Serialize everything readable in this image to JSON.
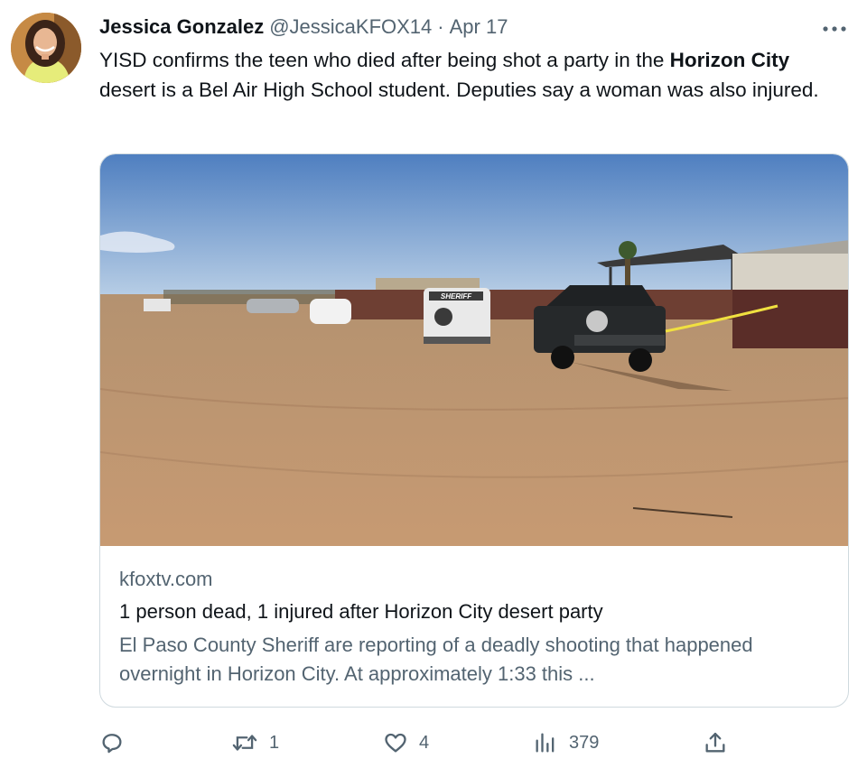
{
  "author": {
    "name": "Jessica Gonzalez",
    "handle": "@JessicaKFOX14",
    "separator": "·",
    "date": "Apr 17"
  },
  "tweet": {
    "text_part1": "YISD confirms the teen who died after being shot a party in the ",
    "text_bold": "Horizon City",
    "text_part2": " desert is a Bel Air High School student. Deputies say a woman was also injured."
  },
  "card": {
    "image_sign": "SHERIFF",
    "domain": "kfoxtv.com",
    "title": "1 person dead, 1 injured after Horizon City desert party",
    "description": "El Paso County Sheriff are reporting of a deadly shooting that happened overnight in Horizon City. At approximately 1:33 this ..."
  },
  "actions": {
    "reply": {
      "icon": "reply-icon",
      "count": ""
    },
    "retweet": {
      "icon": "retweet-icon",
      "count": "1"
    },
    "like": {
      "icon": "heart-icon",
      "count": "4"
    },
    "views": {
      "icon": "views-icon",
      "count": "379"
    },
    "share": {
      "icon": "share-icon"
    }
  },
  "colors": {
    "text_primary": "#0f1419",
    "text_secondary": "#536471",
    "border": "#cfd9de"
  }
}
